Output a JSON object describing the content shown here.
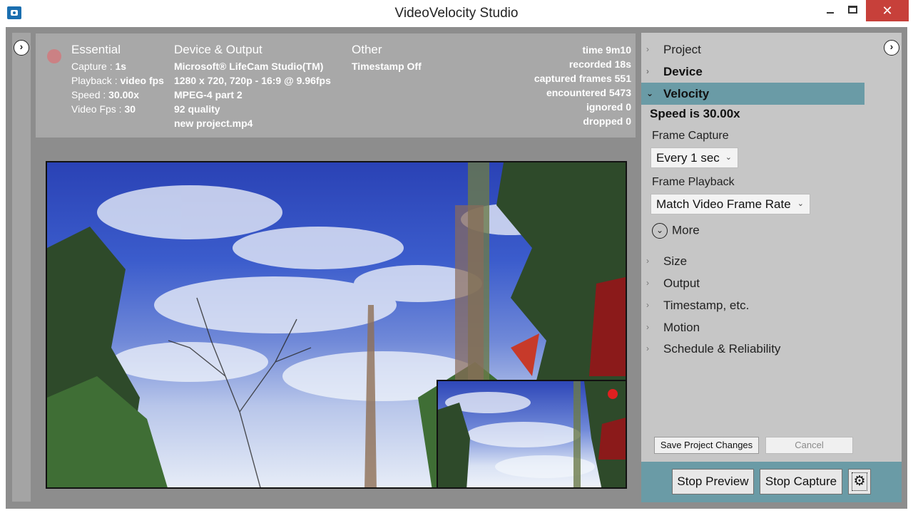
{
  "window": {
    "title": "VideoVelocity Studio",
    "minimize_glyph": "",
    "close_glyph": "✕"
  },
  "left_toggle_glyph": "›",
  "info": {
    "essential": {
      "heading": "Essential",
      "lines": [
        {
          "label": "Capture : ",
          "value": "1s"
        },
        {
          "label": "Playback : ",
          "value": "video fps"
        },
        {
          "label": "Speed : ",
          "value": "30.00x"
        },
        {
          "label": "Video Fps : ",
          "value": "30"
        }
      ]
    },
    "device": {
      "heading": "Device & Output",
      "lines": [
        "Microsoft® LifeCam Studio(TM)",
        "1280 x 720, 720p - 16:9 @ 9.96fps",
        "MPEG-4 part 2",
        "92 quality",
        "new project.mp4"
      ]
    },
    "other": {
      "heading": "Other",
      "lines": [
        "Timestamp Off"
      ]
    },
    "stats": [
      "time 9m10",
      "recorded 18s",
      "captured frames 551",
      "encountered 5473",
      "ignored 0",
      "dropped 0"
    ]
  },
  "right": {
    "toggle_glyph": "›",
    "nav": [
      {
        "label": "Project",
        "chev": "›"
      },
      {
        "label": "Device",
        "chev": "›"
      },
      {
        "label": "Velocity",
        "chev": "⌄"
      },
      {
        "label": "Size",
        "chev": "›"
      },
      {
        "label": "Output",
        "chev": "›"
      },
      {
        "label": "Timestamp, etc.",
        "chev": "›"
      },
      {
        "label": "Motion",
        "chev": "›"
      },
      {
        "label": "Schedule & Reliability",
        "chev": "›"
      }
    ],
    "speed_text": "Speed is 30.00x",
    "frame_capture_label": "Frame Capture",
    "frame_capture_value": "Every 1 sec",
    "frame_playback_label": "Frame Playback",
    "frame_playback_value": "Match Video Frame Rate",
    "combo_arrow": "⌄",
    "more_label": "More",
    "more_glyph": "⌄",
    "save_label": "Save Project Changes",
    "cancel_label": "Cancel",
    "stop_preview_label": "Stop Preview",
    "stop_capture_label": "Stop Capture",
    "gear_glyph": "⚙"
  }
}
